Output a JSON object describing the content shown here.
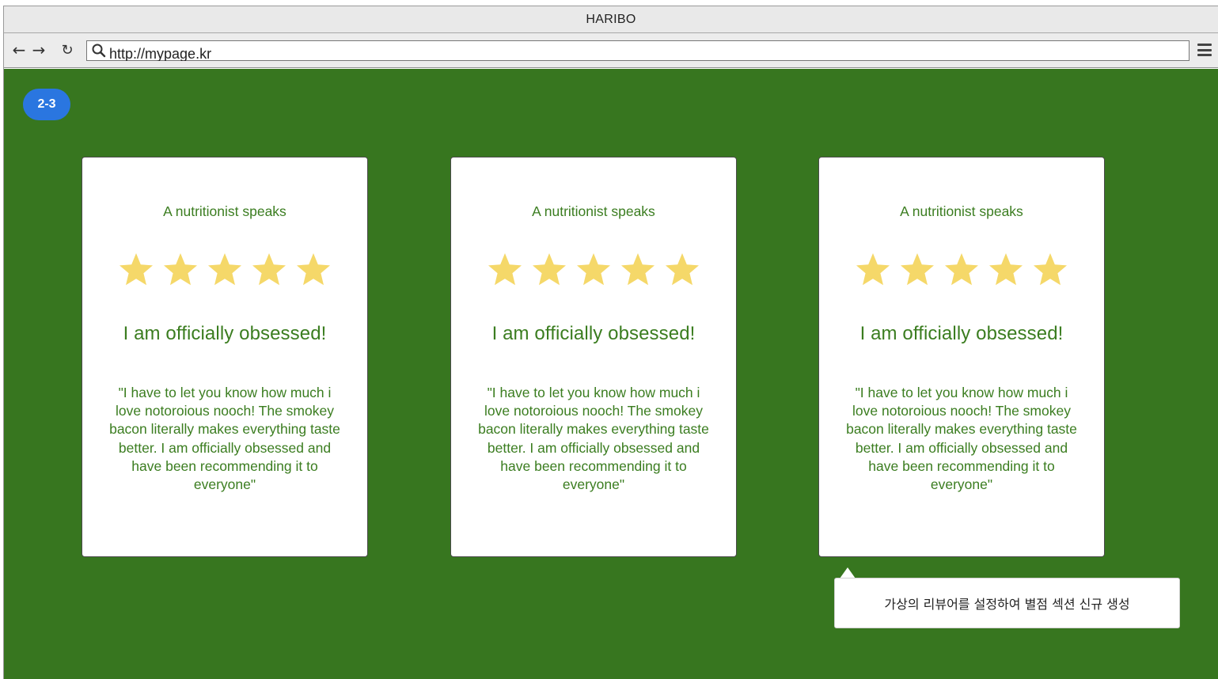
{
  "window": {
    "title": "HARIBO"
  },
  "toolbar": {
    "url": "http://mypage.kr"
  },
  "badge": {
    "label": "2-3",
    "color": "#2a76e0"
  },
  "colors": {
    "background": "#37761f",
    "text": "#3b7d20",
    "star": "#f5d869"
  },
  "reviews": [
    {
      "subtitle": "A nutritionist speaks",
      "rating": 5,
      "headline": "I am officially obsessed!",
      "quote": "\"I have to let you know how much i love notoroious nooch! The smokey bacon literally makes everything taste better. I am officially obsessed and have been recommending it to everyone\""
    },
    {
      "subtitle": "A nutritionist speaks",
      "rating": 5,
      "headline": "I am officially obsessed!",
      "quote": "\"I have to let you know how much i love notoroious nooch! The smokey bacon literally makes everything taste better. I am officially obsessed and have been recommending it to everyone\""
    },
    {
      "subtitle": "A nutritionist speaks",
      "rating": 5,
      "headline": "I am officially obsessed!",
      "quote": "\"I have to let you know how much i love notoroious nooch! The smokey bacon literally makes everything taste better. I am officially obsessed and have been recommending it to everyone\""
    }
  ],
  "tooltip": {
    "text": "가상의 리뷰어를 설정하여 별점 섹션 신규 생성"
  },
  "icons": [
    "back-arrow-icon",
    "forward-arrow-icon",
    "reload-icon",
    "search-icon",
    "menu-icon",
    "star-icon"
  ]
}
